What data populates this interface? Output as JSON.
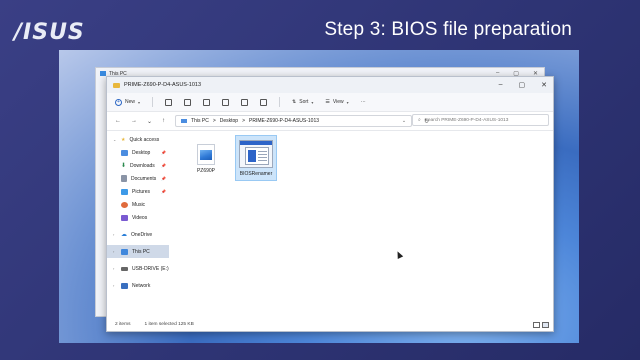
{
  "brand": {
    "logo": "/ISUS"
  },
  "slide": {
    "title": "Step 3: BIOS file preparation"
  },
  "background_window": {
    "title": "This PC"
  },
  "window": {
    "title": "PRIME-Z690-P-D4-ASUS-1013",
    "controls": [
      "–",
      "▢",
      "✕"
    ]
  },
  "ribbon": {
    "new_label": "New",
    "sort_label": "Sort",
    "view_label": "View",
    "more_label": "···"
  },
  "address": {
    "back": "←",
    "forward": "→",
    "recent": "⌄",
    "up": "↑",
    "crumbs": [
      "This PC",
      ">",
      "Desktop",
      ">",
      "PRIME-Z690-P-D4-ASUS-1013"
    ],
    "refresh": "↻",
    "search_placeholder": "Search PRIME-Z690-P-D4-ASUS-1013"
  },
  "nav": {
    "quick_access": "Quick access",
    "pinned": [
      "Desktop",
      "Downloads",
      "Documents",
      "Pictures",
      "Music",
      "Videos"
    ],
    "onedrive": "OneDrive",
    "this_pc": "This PC",
    "usb": "USB-DRIVE (E:)",
    "network": "Network"
  },
  "files": [
    {
      "name": "PZ690P",
      "type": "image",
      "selected": false
    },
    {
      "name": "BIOSRenamer",
      "type": "application",
      "selected": true
    }
  ],
  "status": {
    "items": "2 items",
    "selected": "1 item selected  125 KB"
  },
  "colors": {
    "accent": "#2b66c4",
    "folder": "#e8b73c",
    "selection": "#cce4fa"
  }
}
